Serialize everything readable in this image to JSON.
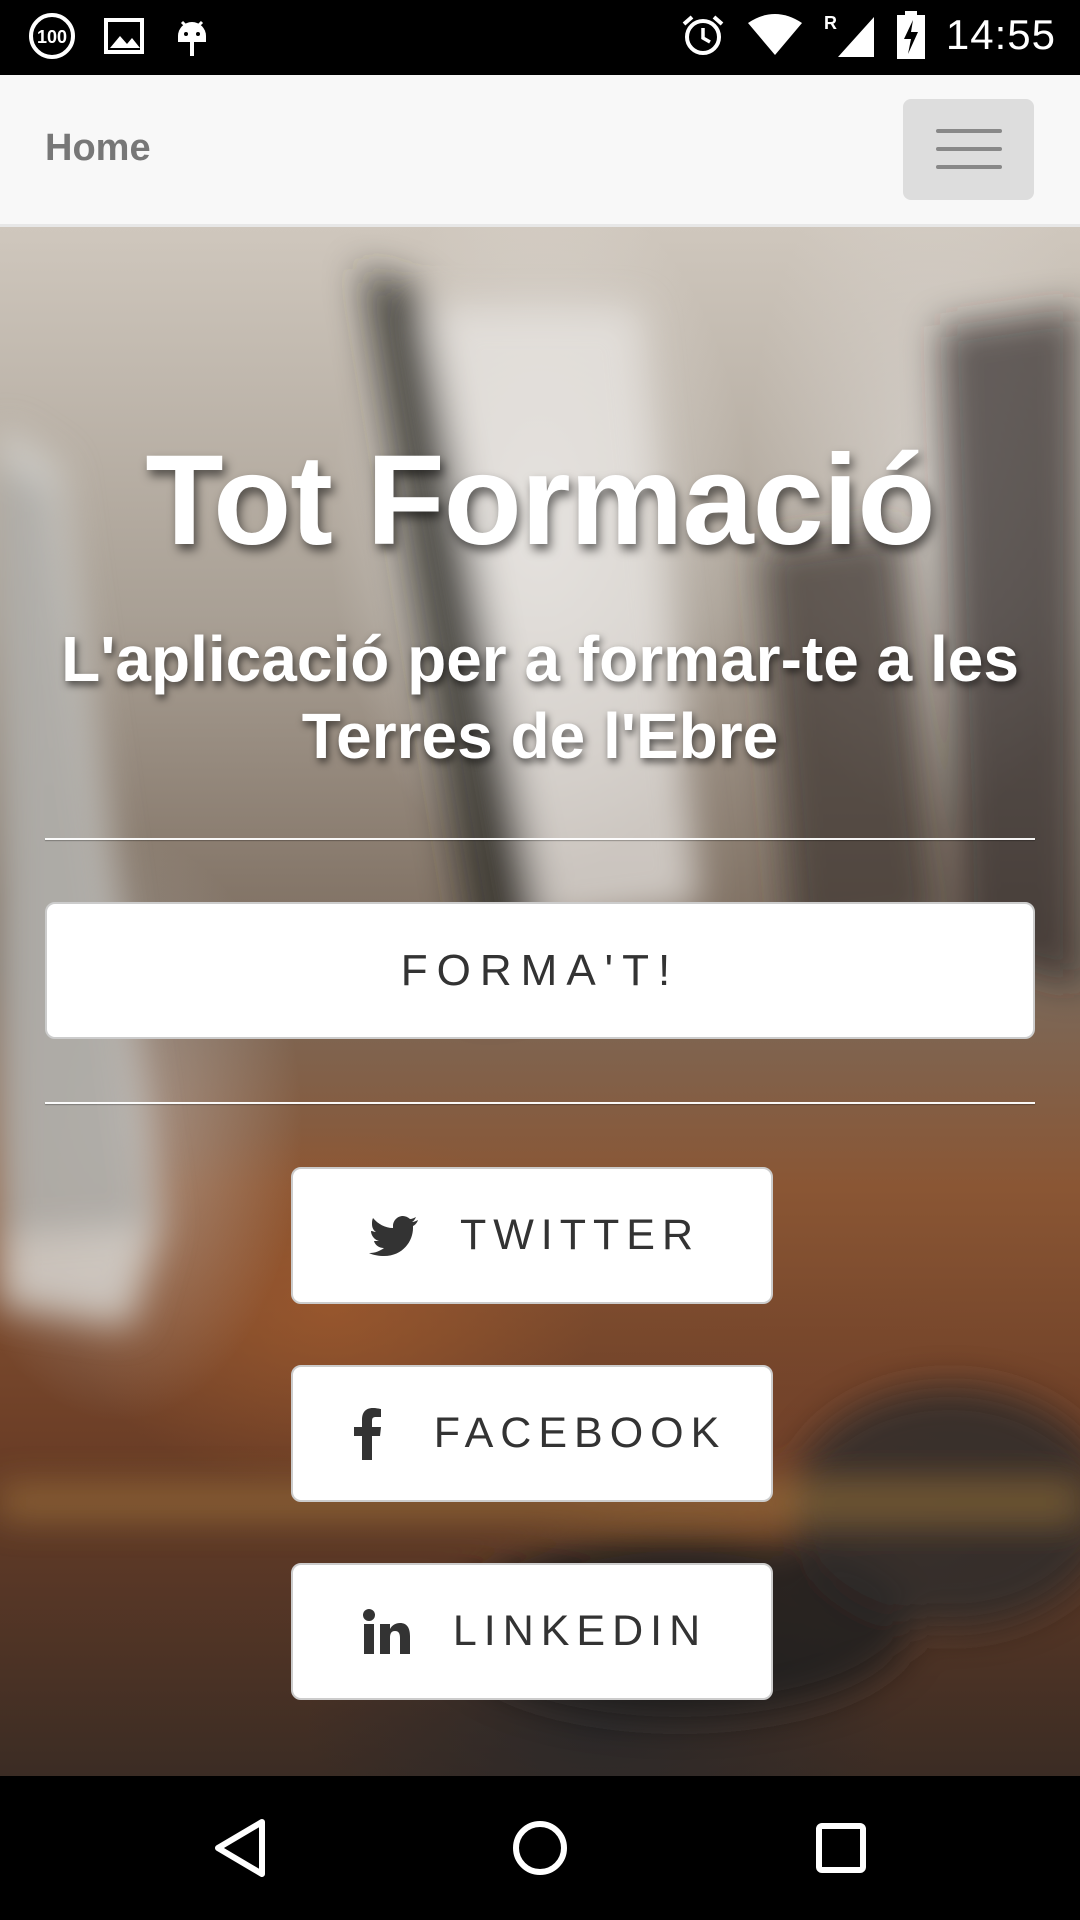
{
  "status_bar": {
    "time": "14:55",
    "icons": [
      "notification-100-icon",
      "image-icon",
      "android-debug-icon",
      "alarm-icon",
      "wifi-icon",
      "signal-roaming-icon",
      "battery-charging-icon"
    ],
    "roaming_label": "R",
    "badge_label": "100"
  },
  "header": {
    "brand": "Home",
    "menu_icon": "hamburger-icon"
  },
  "hero": {
    "title": "Tot Formació",
    "subtitle": "L'aplicació per a formar-te a les Terres de l'Ebre",
    "primary_button": "FORMA'T!"
  },
  "social": [
    {
      "label": "TWITTER",
      "icon": "twitter-icon"
    },
    {
      "label": "FACEBOOK",
      "icon": "facebook-icon"
    },
    {
      "label": "LINKEDIN",
      "icon": "linkedin-icon"
    }
  ],
  "nav_bar": {
    "buttons": [
      "back-icon",
      "home-icon",
      "recents-icon"
    ]
  },
  "colors": {
    "header_bg": "#f8f8f8",
    "brand_text": "#777777",
    "toggle_bg": "#dddddd",
    "button_bg": "#ffffff",
    "button_text": "#333333"
  }
}
